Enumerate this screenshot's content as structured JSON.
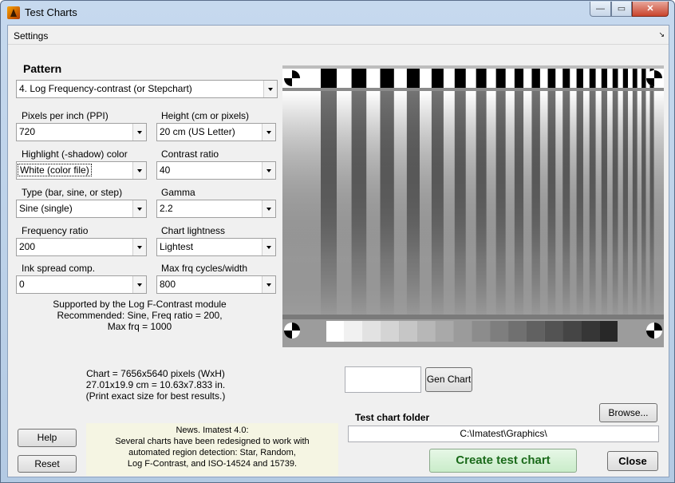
{
  "window": {
    "title": "Test Charts",
    "minimize": "—",
    "maximize": "▭",
    "close": "✕"
  },
  "menu": {
    "settings": "Settings",
    "corner_arrow": "↘"
  },
  "pattern": {
    "label": "Pattern",
    "selected": "4.   Log Frequency-contrast    (or Stepchart)"
  },
  "fields": {
    "ppi": {
      "label": "Pixels per inch (PPI)",
      "value": "720"
    },
    "height": {
      "label": "Height (cm or pixels)",
      "value": "20  cm (US Letter)"
    },
    "highlight": {
      "label": "Highlight (-shadow) color",
      "value": "White  (color file)"
    },
    "contrast": {
      "label": "Contrast ratio",
      "value": "40"
    },
    "type": {
      "label": "Type (bar, sine, or step)",
      "value": "Sine (single)"
    },
    "gamma": {
      "label": "Gamma",
      "value": "2.2"
    },
    "freq_ratio": {
      "label": "Frequency ratio",
      "value": "200"
    },
    "lightness": {
      "label": "Chart lightness",
      "value": "Lightest"
    },
    "ink": {
      "label": "Ink spread comp.",
      "value": "0"
    },
    "max_frq": {
      "label": "Max frq cycles/width",
      "value": "800"
    }
  },
  "supported": {
    "line1": "Supported by the  Log F-Contrast  module",
    "line2": "Recommended:  Sine,  Freq ratio = 200,",
    "line3": "Max frq = 1000"
  },
  "chart_size": {
    "line1": "Chart = 7656x5640 pixels (WxH)",
    "line2": "27.01x19.9 cm = 10.63x7.833 in.",
    "line3": "(Print exact size for best results.)"
  },
  "gen_chart": {
    "input_value": "",
    "button": "Gen Chart"
  },
  "news": {
    "line1": "News.   Imatest 4.0:",
    "line2": "Several charts have been redesigned to work with",
    "line3": "automated region detection:  Star, Random,",
    "line4": "Log F-Contrast, and  ISO-14524 and 15739."
  },
  "folder": {
    "label": "Test chart folder",
    "path": "C:\\Imatest\\Graphics\\",
    "browse": "Browse..."
  },
  "buttons": {
    "help": "Help",
    "reset": "Reset",
    "create": "Create test chart",
    "close": "Close"
  },
  "colors": {
    "window_frame": "#b9cde4",
    "client_bg": "#f0f0f0",
    "news_bg": "#f5f5e3",
    "create_text": "#1a6a1a"
  }
}
